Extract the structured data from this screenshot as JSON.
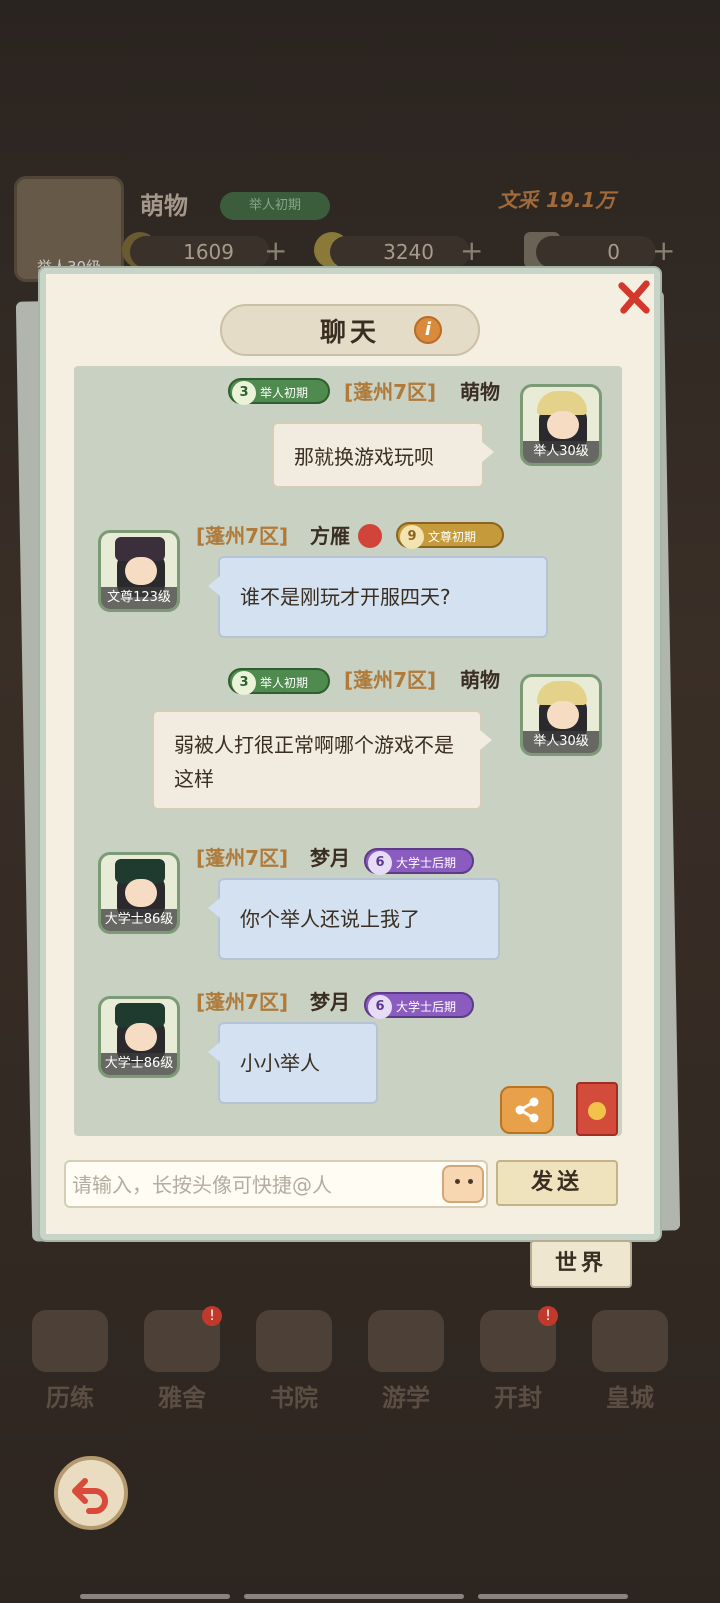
{
  "header": {
    "player_name": "萌物",
    "player_level": "举人30级",
    "player_rank": "举人初期",
    "wencai_label": "文采",
    "wencai_value": "19.1万",
    "copper": "1609",
    "gold": "3240",
    "tickets": "0"
  },
  "chat": {
    "title": "聊天",
    "input_placeholder": "请输入，长按头像可快捷@人",
    "send_label": "发送",
    "channel_label": "世界",
    "messages": [
      {
        "side": "right",
        "server": "[蓬州7区]",
        "name": "萌物",
        "rank_num": "3",
        "rank": "举人初期",
        "avatar_level": "举人30级",
        "text": "那就换游戏玩呗"
      },
      {
        "side": "left",
        "server": "[蓬州7区]",
        "name": "方雁",
        "rank_num": "9",
        "rank": "文尊初期",
        "avatar_level": "文尊123级",
        "text": "谁不是刚玩才开服四天?"
      },
      {
        "side": "right",
        "server": "[蓬州7区]",
        "name": "萌物",
        "rank_num": "3",
        "rank": "举人初期",
        "avatar_level": "举人30级",
        "text": "弱被人打很正常啊哪个游戏不是这样"
      },
      {
        "side": "left",
        "server": "[蓬州7区]",
        "name": "梦月",
        "rank_num": "6",
        "rank": "大学士后期",
        "avatar_level": "大学士86级",
        "text": "你个举人还说上我了"
      },
      {
        "side": "left",
        "server": "[蓬州7区]",
        "name": "梦月",
        "rank_num": "6",
        "rank": "大学士后期",
        "avatar_level": "大学士86级",
        "text": "小小举人"
      }
    ]
  },
  "nav": {
    "items": [
      {
        "label": "历练"
      },
      {
        "label": "雅舍",
        "badge": "!"
      },
      {
        "label": "书院"
      },
      {
        "label": "游学"
      },
      {
        "label": "开封",
        "badge": "!"
      },
      {
        "label": "皇城"
      }
    ]
  },
  "colors": {
    "panel_bg": "#f4efe1",
    "chat_area_bg": "#c8d1c2",
    "server_text": "#b07a3a",
    "close_red": "#d2392c",
    "bubble_blue": "#d4e1f0"
  }
}
